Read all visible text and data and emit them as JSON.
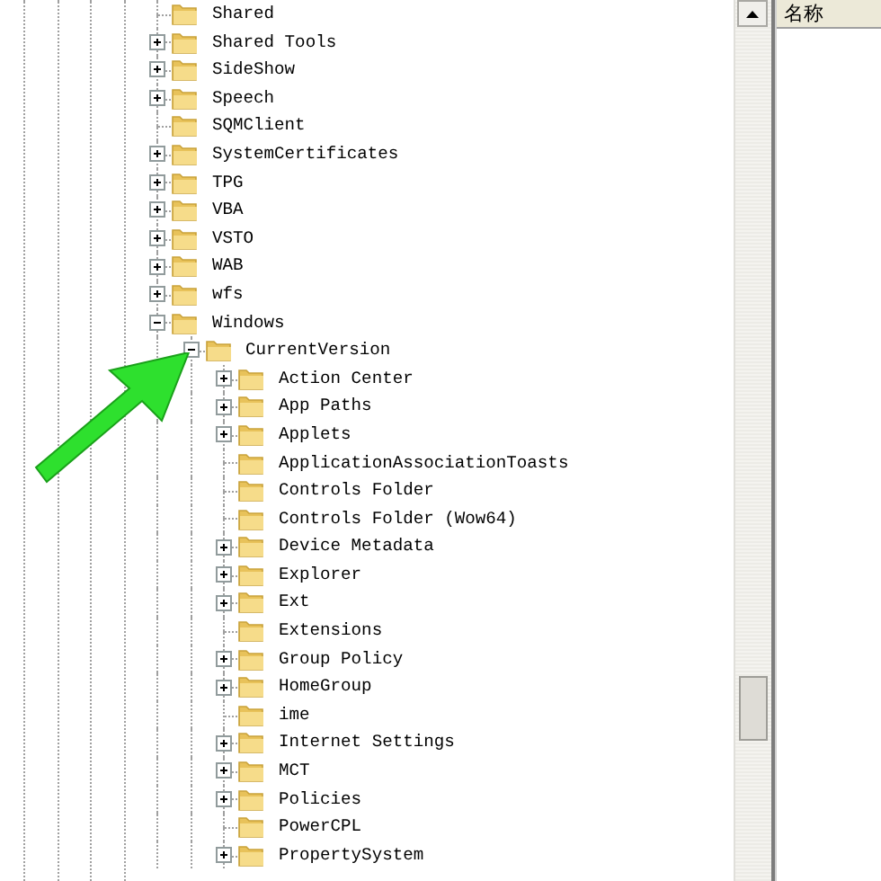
{
  "tree": [
    {
      "label": "Shared",
      "kind": "leaf"
    },
    {
      "label": "Shared Tools",
      "kind": "branch",
      "expanded": false
    },
    {
      "label": "SideShow",
      "kind": "branch",
      "expanded": false
    },
    {
      "label": "Speech",
      "kind": "branch",
      "expanded": false
    },
    {
      "label": "SQMClient",
      "kind": "leaf"
    },
    {
      "label": "SystemCertificates",
      "kind": "branch",
      "expanded": false
    },
    {
      "label": "TPG",
      "kind": "branch",
      "expanded": false
    },
    {
      "label": "VBA",
      "kind": "branch",
      "expanded": false
    },
    {
      "label": "VSTO",
      "kind": "branch",
      "expanded": false
    },
    {
      "label": "WAB",
      "kind": "branch",
      "expanded": false
    },
    {
      "label": "wfs",
      "kind": "branch",
      "expanded": false
    },
    {
      "label": "Windows",
      "kind": "branch",
      "expanded": true,
      "children": [
        {
          "label": "CurrentVersion",
          "kind": "branch",
          "expanded": true,
          "children": [
            {
              "label": "Action Center",
              "kind": "branch",
              "expanded": false
            },
            {
              "label": "App Paths",
              "kind": "branch",
              "expanded": false
            },
            {
              "label": "Applets",
              "kind": "branch",
              "expanded": false
            },
            {
              "label": "ApplicationAssociationToasts",
              "kind": "leaf"
            },
            {
              "label": "Controls Folder",
              "kind": "leaf"
            },
            {
              "label": "Controls Folder (Wow64)",
              "kind": "leaf"
            },
            {
              "label": "Device Metadata",
              "kind": "branch",
              "expanded": false
            },
            {
              "label": "Explorer",
              "kind": "branch",
              "expanded": false
            },
            {
              "label": "Ext",
              "kind": "branch",
              "expanded": false
            },
            {
              "label": "Extensions",
              "kind": "leaf"
            },
            {
              "label": "Group Policy",
              "kind": "branch",
              "expanded": false
            },
            {
              "label": "HomeGroup",
              "kind": "branch",
              "expanded": false
            },
            {
              "label": "ime",
              "kind": "leaf"
            },
            {
              "label": "Internet Settings",
              "kind": "branch",
              "expanded": false
            },
            {
              "label": "MCT",
              "kind": "branch",
              "expanded": false
            },
            {
              "label": "Policies",
              "kind": "branch",
              "expanded": false
            },
            {
              "label": "PowerCPL",
              "kind": "leaf"
            },
            {
              "label": "PropertySystem",
              "kind": "branch",
              "expanded": false
            }
          ]
        }
      ]
    }
  ],
  "list_pane": {
    "columns": [
      "名称"
    ]
  }
}
